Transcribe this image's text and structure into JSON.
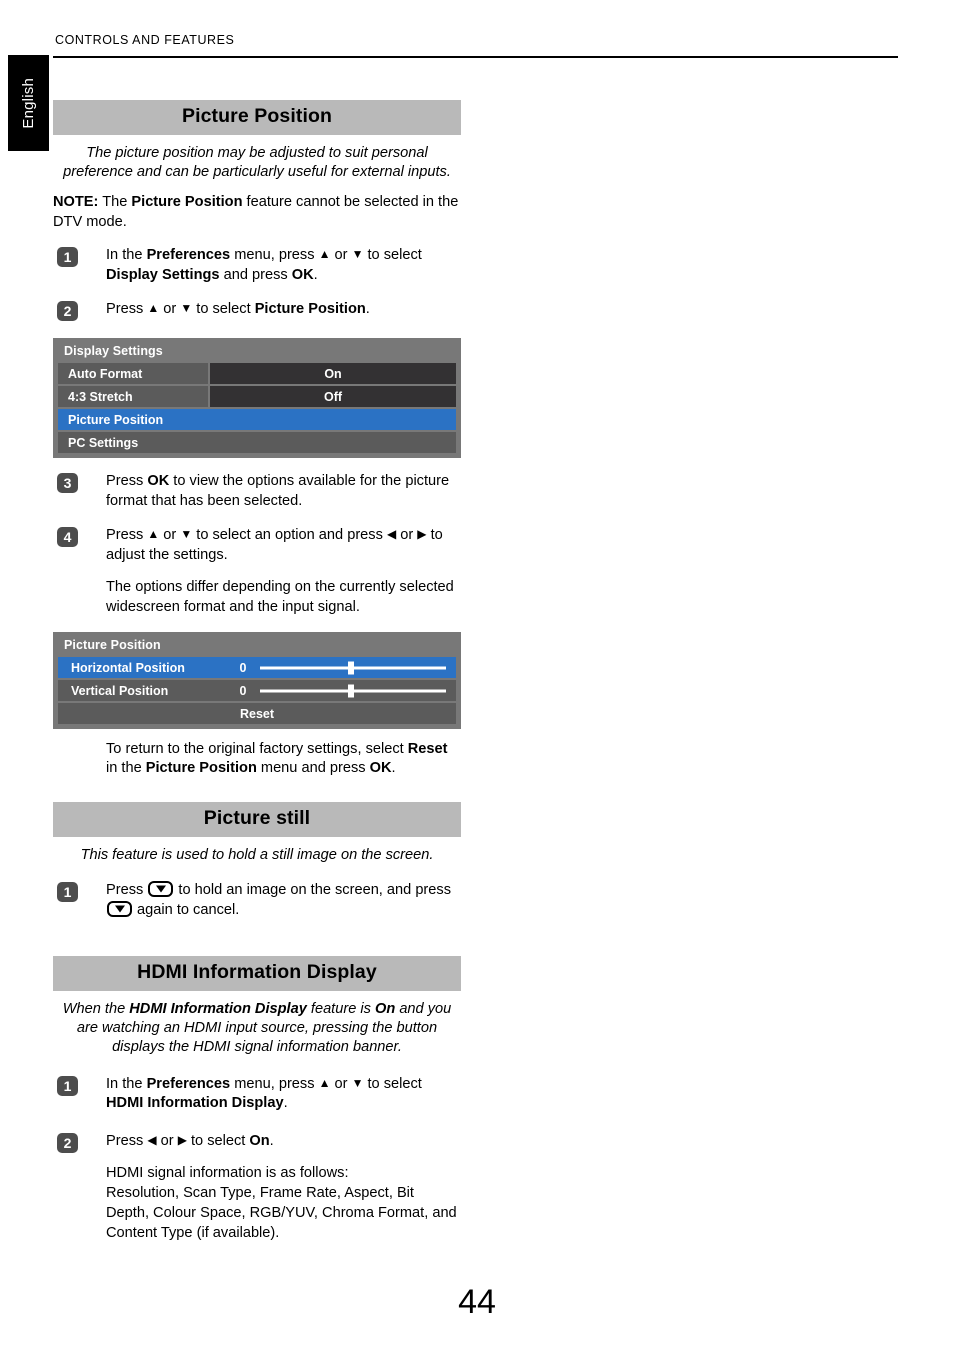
{
  "page": {
    "running_header": "CONTROLS AND FEATURES",
    "language_tab": "English",
    "page_number": "44"
  },
  "colors": {
    "section_bar": "#b9b9b9",
    "osd_background": "#787878",
    "osd_row": "#5b5b5b",
    "osd_value": "#333133",
    "osd_highlight": "#2b72c4",
    "badge": "#4d4d4d",
    "tab_background": "#000000"
  },
  "sections": [
    {
      "id": "picture-position",
      "heading": "Picture Position",
      "intro": "The picture position may be adjusted to suit personal preference and can be particularly useful for external inputs.",
      "note_prefix": "NOTE:",
      "note_body_1": " The ",
      "note_bold": "Picture Position",
      "note_body_2": " feature cannot be selected in the DTV mode.",
      "steps": [
        {
          "number": "1",
          "t1": "In the ",
          "b1": "Preferences",
          "t2": " menu, press ",
          "up": "▲",
          "t3": " or ",
          "down": "▼",
          "t4": " to select ",
          "b2": "Display Settings",
          "t5": " and press ",
          "b3": "OK",
          "t6": "."
        },
        {
          "number": "2",
          "t1": "Press ",
          "up": "▲",
          "t2": " or ",
          "down": "▼",
          "t3": " to select ",
          "b1": "Picture Position",
          "t4": "."
        },
        {
          "number": "3",
          "t1": "Press ",
          "b1": "OK",
          "t2": " to view the options available for the picture format that has been selected."
        },
        {
          "number": "4",
          "t1": "Press ",
          "up": "▲",
          "t2": " or ",
          "down": "▼",
          "t3": " to select an option and press ",
          "left": "◀",
          "t4": " or ",
          "right": "▶",
          "t5": " to adjust the settings.",
          "sub": "The options differ depending on the currently selected widescreen format and the input signal."
        }
      ],
      "closing": {
        "t1": "To return to the original factory settings, select ",
        "b1": "Reset",
        "t2": " in the ",
        "b2": "Picture Position",
        "t3": " menu and press ",
        "b3": "OK",
        "t4": "."
      }
    },
    {
      "id": "picture-still",
      "heading": "Picture still",
      "intro": "This feature is used to hold a still image on the screen.",
      "steps": [
        {
          "number": "1",
          "t1": "Press ",
          "key1": "down-arrow-key",
          "t2": " to hold an image on the screen, and press ",
          "key2": "down-arrow-key",
          "t3": " again to cancel."
        }
      ]
    },
    {
      "id": "hdmi-information-display",
      "heading": "HDMI Information Display",
      "intro_t1": "When the ",
      "intro_b1": "HDMI Information Display",
      "intro_t2": " feature is ",
      "intro_b2": "On",
      "intro_t3": " and you are watching an HDMI input source, pressing the button displays the HDMI signal information banner.",
      "steps": [
        {
          "number": "1",
          "t1": "In the ",
          "b1": "Preferences",
          "t2": " menu, press ",
          "up": "▲",
          "t3": " or ",
          "down": "▼",
          "t4": " to select ",
          "b2": "HDMI Information Display",
          "t5": "."
        },
        {
          "number": "2",
          "t1": "Press ",
          "left": "◀",
          "t2": " or ",
          "right": "▶",
          "t3": " to select ",
          "b1": "On",
          "t4": ".",
          "sub_line1": "HDMI signal information is as follows:",
          "sub_line2": "Resolution, Scan Type, Frame Rate, Aspect, Bit Depth, Colour Space, RGB/YUV, Chroma Format, and Content Type (if available)."
        }
      ]
    }
  ],
  "osd_display_settings": {
    "title": "Display Settings",
    "rows": [
      {
        "label": "Auto Format",
        "value": "On",
        "selected": false
      },
      {
        "label": "4:3 Stretch",
        "value": "Off",
        "selected": false
      },
      {
        "label": "Picture Position",
        "value": "",
        "selected": true
      },
      {
        "label": "PC Settings",
        "value": "",
        "selected": false
      }
    ]
  },
  "osd_picture_position": {
    "title": "Picture Position",
    "rows": [
      {
        "label": "Horizontal Position",
        "value": "0",
        "selected": true
      },
      {
        "label": "Vertical Position",
        "value": "0",
        "selected": false
      }
    ],
    "reset_label": "Reset"
  }
}
